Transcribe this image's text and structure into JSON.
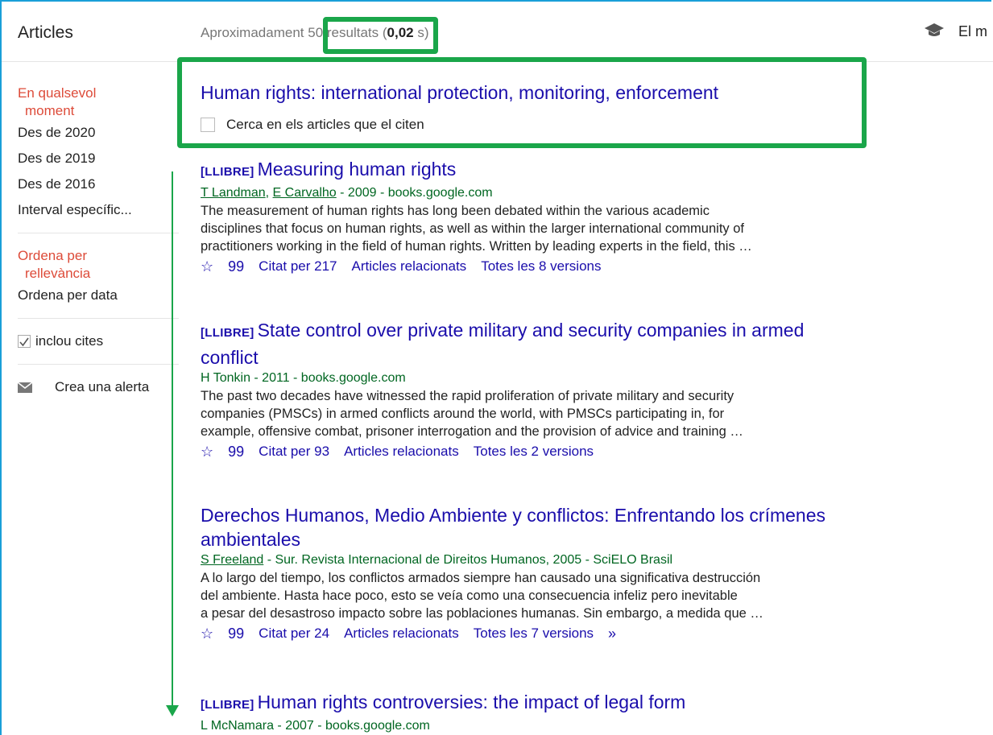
{
  "header": {
    "section_title": "Articles",
    "results_prefix": "Aproximadament",
    "results_count": "50 resultats",
    "results_time": "0,02",
    "results_time_suffix": " s)",
    "library_label": "El m"
  },
  "sidebar": {
    "time_active_line1": "En qualsevol",
    "time_active_line2": "moment",
    "time_items": [
      "Des de 2020",
      "Des de 2019",
      "Des de 2016",
      "Interval específic..."
    ],
    "sort_active_line1": "Ordena per",
    "sort_active_line2": "rellevància",
    "sort_other": "Ordena per data",
    "include_citations": "inclou cites",
    "create_alert": "Crea una alerta"
  },
  "cited_work": {
    "title": "Human rights: international protection, monitoring, enforcement",
    "search_within": "Cerca en els articles que el citen"
  },
  "results": [
    {
      "tag": "[LLIBRE]",
      "title": "Measuring human rights",
      "author1": "T Landman",
      "author2": "E Carvalho",
      "source": " - 2009 - books.google.com",
      "snippet1": "The measurement of human rights has long been debated within the various academic",
      "snippet2": "disciplines that focus on human rights, as well as within the larger international community of",
      "snippet3": "practitioners working in the field of human rights. Written by leading experts in the field, this …",
      "cited_by": "Citat per 217",
      "related": "Articles relacionats",
      "versions": "Totes les 8 versions"
    },
    {
      "tag": "[LLIBRE]",
      "title_line1": "State control over private military and security companies in armed",
      "title_line2": "conflict",
      "source": "H Tonkin - 2011 - books.google.com",
      "snippet1": "The past two decades have witnessed the rapid proliferation of private military and security",
      "snippet2": "companies (PMSCs) in armed conflicts around the world, with PMSCs participating in, for",
      "snippet3": "example, offensive combat, prisoner interrogation and the provision of advice and training …",
      "cited_by": "Citat per 93",
      "related": "Articles relacionats",
      "versions": "Totes les 2 versions"
    },
    {
      "title_line1": "Derechos Humanos, Medio Ambiente y conflictos: Enfrentando los crímenes",
      "title_line2": "ambientales",
      "author1": "S Freeland",
      "source": " - Sur. Revista Internacional de Direitos Humanos, 2005 - SciELO Brasil",
      "snippet1": "A lo largo del tiempo, los conflictos armados siempre han causado una significativa destrucción",
      "snippet2": "del ambiente. Hasta hace poco, esto se veía como una consecuencia infeliz pero inevitable",
      "snippet3": "a pesar del desastroso impacto sobre las poblaciones humanas. Sin embargo, a medida que …",
      "cited_by": "Citat per 24",
      "related": "Articles relacionats",
      "versions": "Totes les 7 versions"
    },
    {
      "tag": "[LLIBRE]",
      "title": "Human rights controversies: the impact of legal form",
      "source": "L McNamara - 2007 - books.google.com"
    }
  ],
  "icons": {
    "star": "☆",
    "cite": "99",
    "more": "»"
  },
  "colors": {
    "link": "#1a0dab",
    "green_text": "#006621",
    "active": "#dd4b39",
    "annotation": "#1aa64a"
  }
}
